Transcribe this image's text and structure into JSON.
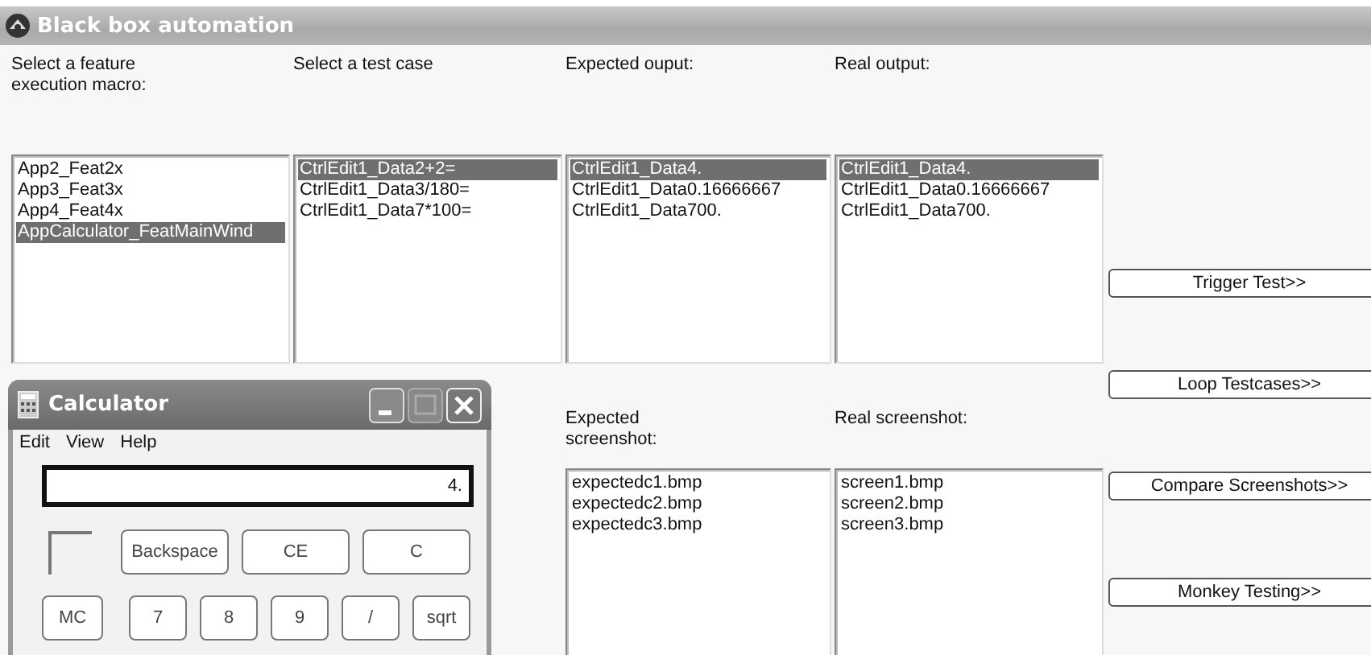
{
  "window": {
    "title": "Black box automation"
  },
  "output_columns": [
    {
      "label": "Select a feature\nexecution macro:",
      "items": [
        {
          "text": "App2_Feat2x",
          "selected": false
        },
        {
          "text": "App3_Feat3x",
          "selected": false
        },
        {
          "text": "App4_Feat4x",
          "selected": false
        },
        {
          "text": "AppCalculator_FeatMainWind",
          "selected": true
        }
      ]
    },
    {
      "label": "Select a test case",
      "items": [
        {
          "text": "CtrlEdit1_Data2+2=",
          "selected": true
        },
        {
          "text": "CtrlEdit1_Data3/180=",
          "selected": false
        },
        {
          "text": "CtrlEdit1_Data7*100=",
          "selected": false
        }
      ]
    },
    {
      "label": "Expected ouput:",
      "items": [
        {
          "text": "CtrlEdit1_Data4.",
          "selected": true
        },
        {
          "text": "CtrlEdit1_Data0.16666667",
          "selected": false
        },
        {
          "text": "CtrlEdit1_Data700.",
          "selected": false
        }
      ]
    },
    {
      "label": "Real output:",
      "items": [
        {
          "text": "CtrlEdit1_Data4.",
          "selected": true
        },
        {
          "text": "CtrlEdit1_Data0.16666667",
          "selected": false
        },
        {
          "text": "CtrlEdit1_Data700.",
          "selected": false
        }
      ]
    }
  ],
  "screenshot_columns": [
    {
      "label": "Expected\nscreenshot:",
      "items": [
        {
          "text": "expectedc1.bmp",
          "selected": false
        },
        {
          "text": "expectedc2.bmp",
          "selected": false
        },
        {
          "text": "expectedc3.bmp",
          "selected": false
        }
      ]
    },
    {
      "label": "Real screenshot:",
      "items": [
        {
          "text": "screen1.bmp",
          "selected": false
        },
        {
          "text": "screen2.bmp",
          "selected": false
        },
        {
          "text": "screen3.bmp",
          "selected": false
        }
      ]
    }
  ],
  "buttons": [
    "Trigger Test>>",
    "Loop Testcases>>",
    "Compare Screenshots>>",
    "Monkey Testing>>"
  ],
  "calculator": {
    "title": "Calculator",
    "menu": [
      "Edit",
      "View",
      "Help"
    ],
    "display": "4.",
    "key_rows": [
      [
        "Backspace",
        "CE",
        "C"
      ],
      [
        "MC",
        "7",
        "8",
        "9",
        "/",
        "sqrt"
      ]
    ]
  }
}
